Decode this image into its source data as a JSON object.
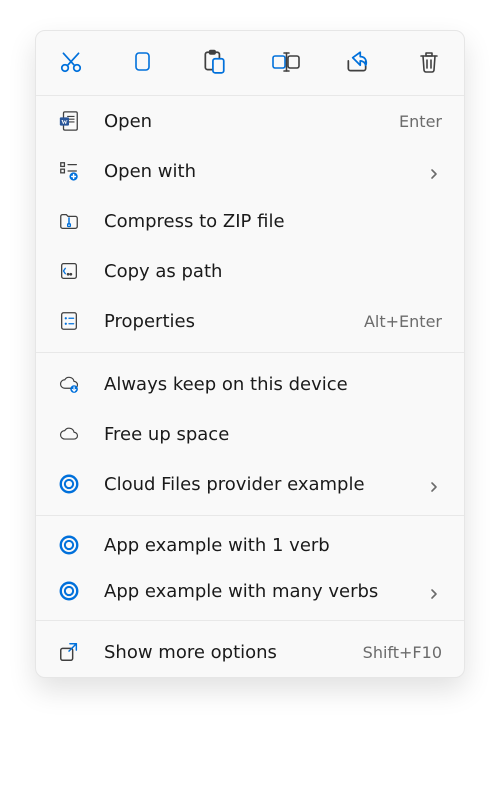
{
  "toolbar": {
    "cut": "Cut",
    "copy": "Copy",
    "paste": "Paste",
    "rename": "Rename",
    "share": "Share",
    "delete": "Delete"
  },
  "menu": {
    "open": {
      "label": "Open",
      "shortcut": "Enter"
    },
    "open_with": {
      "label": "Open with"
    },
    "compress": {
      "label": "Compress to ZIP file"
    },
    "copy_path": {
      "label": "Copy as path"
    },
    "properties": {
      "label": "Properties",
      "shortcut": "Alt+Enter"
    },
    "always_keep": {
      "label": "Always keep on this device"
    },
    "free_up": {
      "label": "Free up space"
    },
    "cloud_provider": {
      "label": "Cloud Files provider example"
    },
    "app_one_verb": {
      "label": "App example with 1 verb"
    },
    "app_many_verbs": {
      "label": "App example with many verbs"
    },
    "show_more": {
      "label": "Show more options",
      "shortcut": "Shift+F10"
    }
  },
  "colors": {
    "accent": "#0070db",
    "text": "#1a1a1a",
    "muted": "#6b6b6b",
    "stroke": "#404040"
  }
}
